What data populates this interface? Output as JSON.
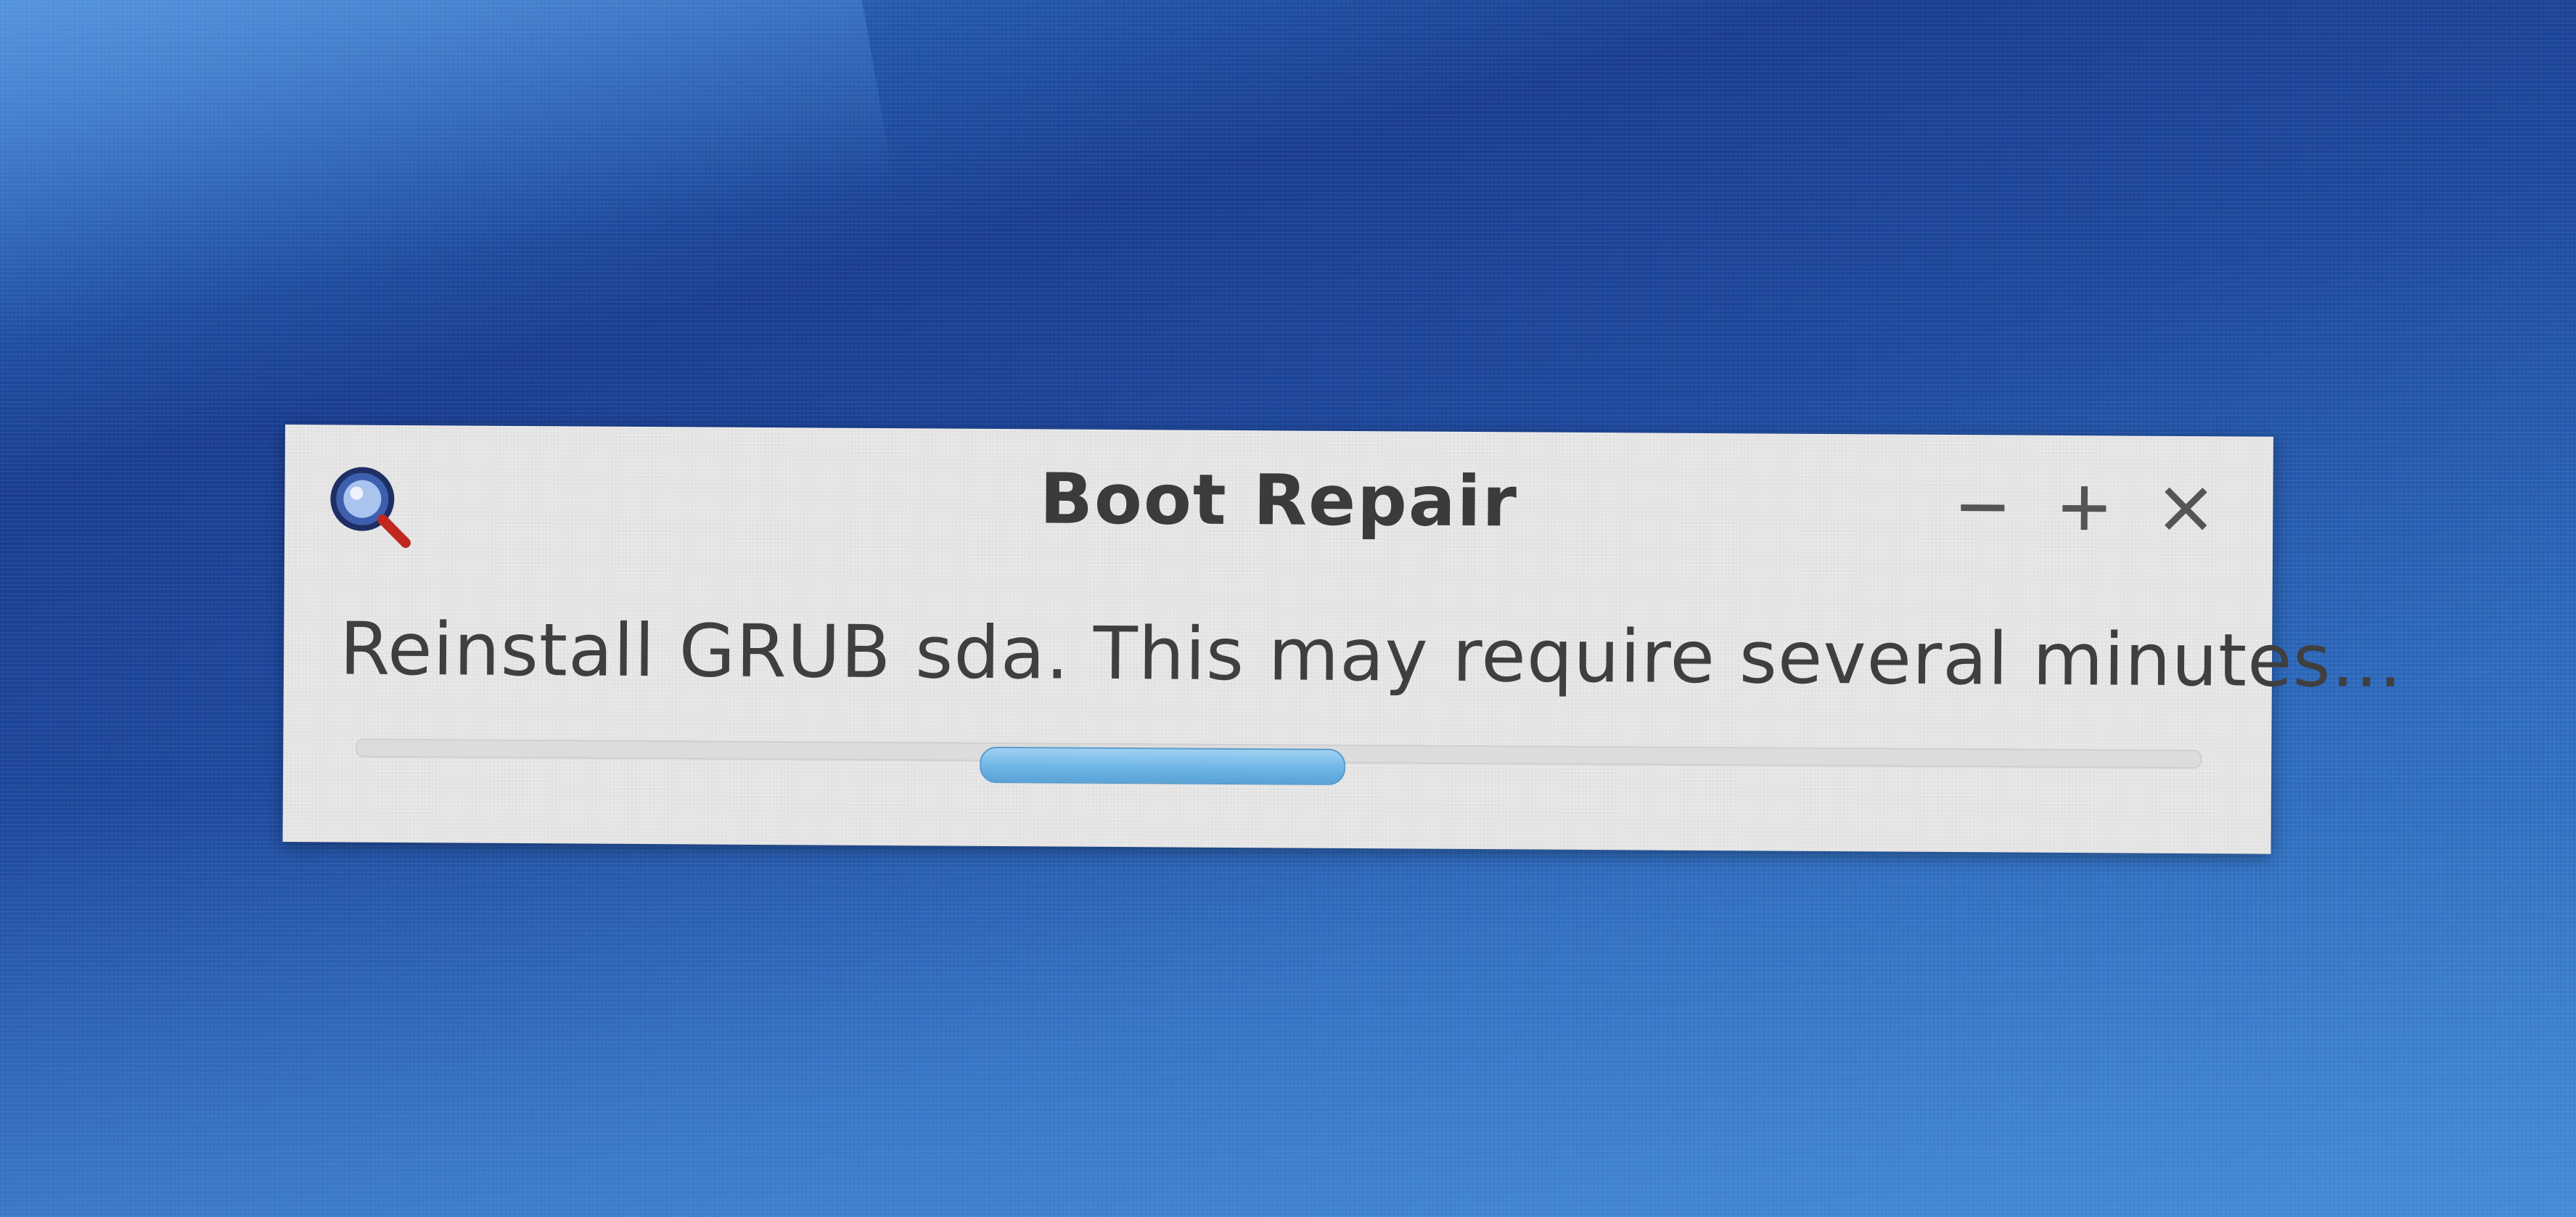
{
  "window": {
    "title": "Boot Repair",
    "icon": "magnifier-icon",
    "controls": {
      "minimize": "minimize-icon",
      "maximize": "maximize-icon",
      "close": "close-icon"
    }
  },
  "dialog": {
    "message": "Reinstall GRUB sda. This may require several minutes...",
    "progress": {
      "mode": "indeterminate",
      "color": "#6fb6e6"
    }
  },
  "colors": {
    "desktop": "#1f4aa0",
    "window_bg": "#e9e9e9",
    "text": "#3f3f3f"
  }
}
